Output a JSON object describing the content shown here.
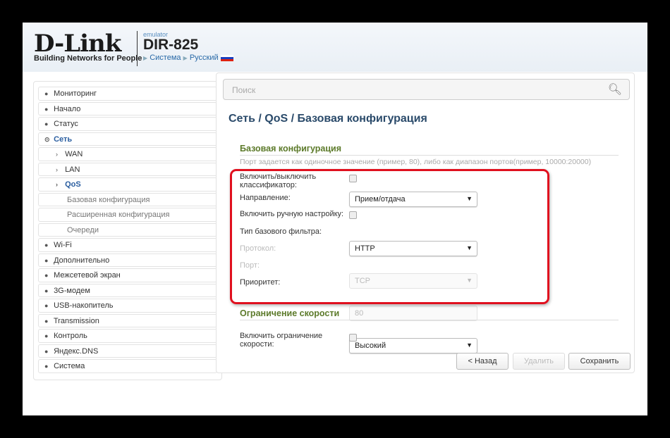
{
  "header": {
    "logo": "D-Link",
    "tagline": "Building Networks for People",
    "emulator": "emulator",
    "model": "DIR-825",
    "breadcrumbs": [
      "Система",
      "Русский"
    ]
  },
  "sidebar": {
    "items": [
      {
        "label": "Мониторинг"
      },
      {
        "label": "Начало"
      },
      {
        "label": "Статус"
      },
      {
        "label": "Сеть"
      },
      {
        "label": "WAN"
      },
      {
        "label": "LAN"
      },
      {
        "label": "QoS"
      },
      {
        "label": "Базовая конфигурация"
      },
      {
        "label": "Расширенная конфигурация"
      },
      {
        "label": "Очереди"
      },
      {
        "label": "Wi-Fi"
      },
      {
        "label": "Дополнительно"
      },
      {
        "label": "Межсетевой экран"
      },
      {
        "label": "3G-модем"
      },
      {
        "label": "USB-накопитель"
      },
      {
        "label": "Transmission"
      },
      {
        "label": "Контроль"
      },
      {
        "label": "Яндекс.DNS"
      },
      {
        "label": "Система"
      }
    ]
  },
  "search": {
    "placeholder": "Поиск"
  },
  "main": {
    "title": "Сеть /  QoS /  Базовая конфигурация",
    "section1": "Базовая конфигурация",
    "hint": "Порт задается как одиночное значение (пример, 80), либо как диапазон портов(пример, 10000:20000)",
    "fields": {
      "classifier": "Включить/выключить классификатор:",
      "direction": "Направление:",
      "direction_value": "Прием/отдача",
      "manual": "Включить ручную настройку:",
      "filter": "Тип базового фильтра:",
      "filter_value": "HTTP",
      "protocol": "Протокол:",
      "protocol_value": "TCP",
      "port": "Порт:",
      "port_value": "80",
      "priority": "Приоритет:",
      "priority_value": "Высокий"
    },
    "section2": "Ограничение скорости",
    "speed_limit": "Включить ограничение скорости:"
  },
  "buttons": {
    "back": "< Назад",
    "delete": "Удалить",
    "save": "Сохранить"
  }
}
